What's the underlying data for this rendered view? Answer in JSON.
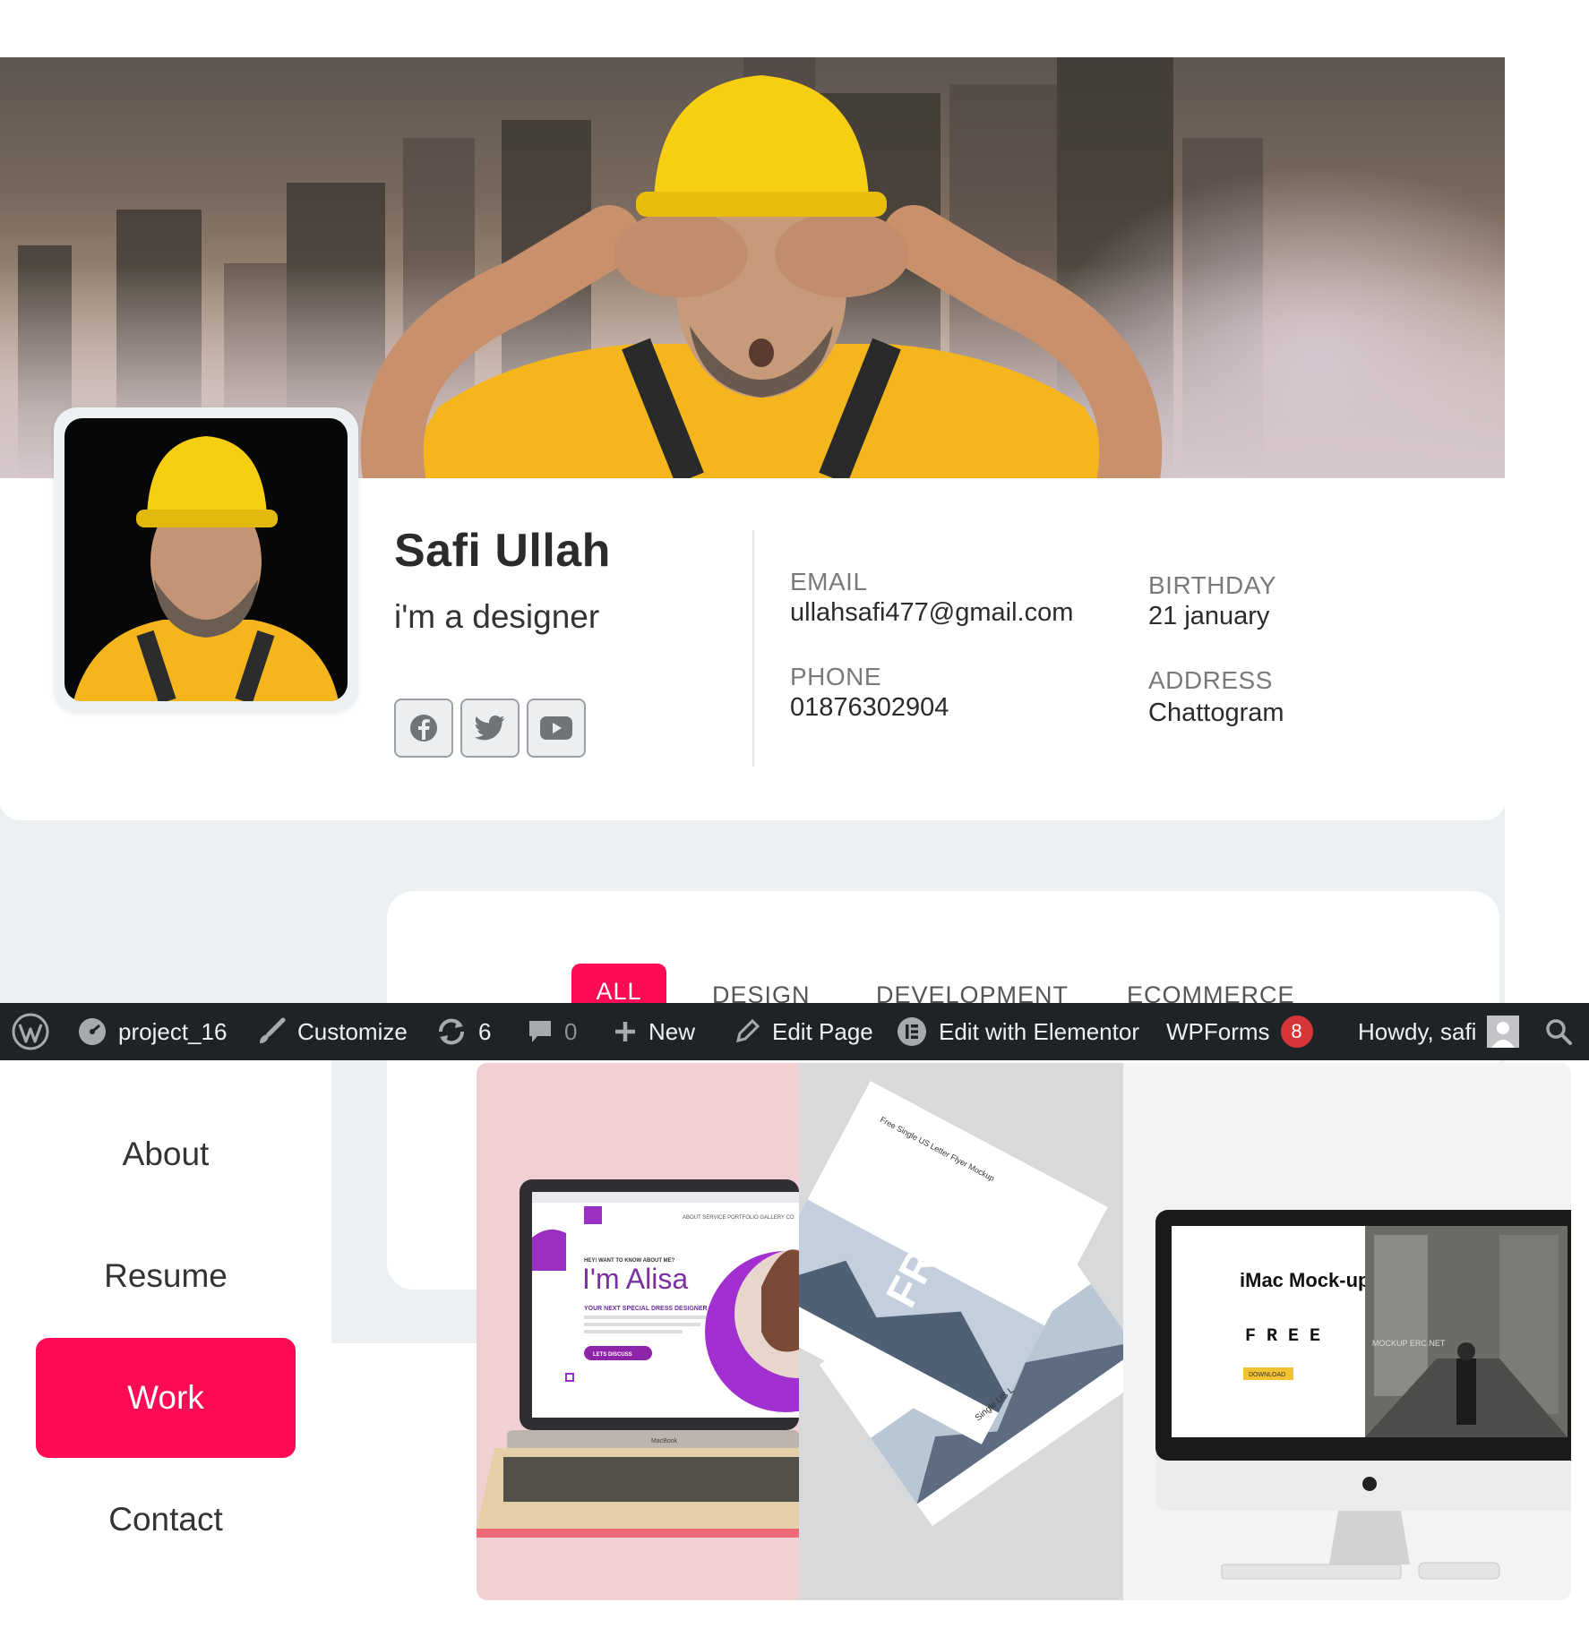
{
  "profile": {
    "name": "Safi Ullah",
    "role": "i'm a designer",
    "social": [
      "facebook-icon",
      "twitter-icon",
      "youtube-icon"
    ]
  },
  "info": {
    "email_label": "EMAIL",
    "email": "ullahsafi477@gmail.com",
    "phone_label": "PHONE",
    "phone": "01876302904",
    "birthday_label": "BIRTHDAY",
    "birthday": "21 january",
    "address_label": "ADDRESS",
    "address": "Chattogram"
  },
  "filters": [
    "ALL",
    "DESIGN",
    "DEVELOPMENT",
    "ECOMMERCE"
  ],
  "adminbar": {
    "site": "project_16",
    "customize": "Customize",
    "updates": "6",
    "comments": "0",
    "new": "New",
    "edit_page": "Edit Page",
    "edit_elementor": "Edit with Elementor",
    "wpforms": "WPForms",
    "wpforms_count": "8",
    "howdy": "Howdy, safi"
  },
  "nav": [
    "About",
    "Resume",
    "Work",
    "Contact"
  ],
  "thumbs": {
    "laptop": {
      "nav": "ABOUT   SERVICE   PORTFOLIO   GALLERY   CO",
      "kicker": "HEY! WANT TO KNOW ABOUT ME?",
      "headline": "I'm Alisa",
      "sub": "YOUR NEXT SPECIAL DRESS DESIGNER",
      "button": "LETS DISCUSS",
      "brand": "MacBook"
    },
    "flyer": {
      "title": "Free Single US Letter Flyer Mockup",
      "big": "FREE",
      "side": "Single US L"
    },
    "imac": {
      "title": "iMac Mock-ups",
      "free": "F R E E",
      "download": "DOWNLOAD",
      "watermark": "MOCKUP  ERC.NET"
    }
  },
  "colors": {
    "accent": "#ff0a54",
    "adminbar": "#1d2327",
    "badge": "#d63638"
  }
}
